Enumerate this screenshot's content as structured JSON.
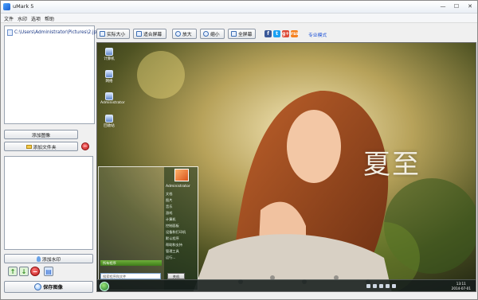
{
  "window": {
    "title": "uMark 5",
    "min_glyph": "—",
    "max_glyph": "☐",
    "close_glyph": "✕"
  },
  "menu": [
    "文件",
    "水印",
    "选项",
    "帮助"
  ],
  "file_list": {
    "items": [
      "C:\\Users\\Administrator\\Pictures\\2.jpg"
    ]
  },
  "left_buttons": {
    "add_image": "添加图像",
    "add_folder": "添加文件夹",
    "add_watermark": "添加水印",
    "save_image": "保存图像"
  },
  "toolbar": {
    "actual_size": "实际大小",
    "fit_screen": "适合屏幕",
    "zoom_in": "放大",
    "zoom_out": "缩小",
    "full_screen": "全屏幕",
    "social": [
      "f",
      "t",
      "g+",
      "rss"
    ],
    "pro_mode": "专业模式"
  },
  "preview": {
    "desktop_icons": [
      "计算机",
      "网络",
      "Administrator",
      "回收站"
    ],
    "calligraphy": "夏至",
    "start_menu": {
      "user": "Administrator",
      "items": [
        "文档",
        "图片",
        "音乐",
        "游戏",
        "计算机",
        "控制面板",
        "设备和打印机",
        "默认程序",
        "帮助和支持"
      ],
      "right_items": [
        "管理工具",
        "运行..."
      ],
      "all_programs": "所有程序",
      "search_placeholder": "搜索程序和文件",
      "shutdown": "关机"
    },
    "clock": {
      "time": "13:11",
      "date": "2014-07-01"
    }
  },
  "colors": {
    "accent_link": "#1a4fd6",
    "window_bg": "#f0f0f0",
    "start_green": "#3f7d1a"
  }
}
